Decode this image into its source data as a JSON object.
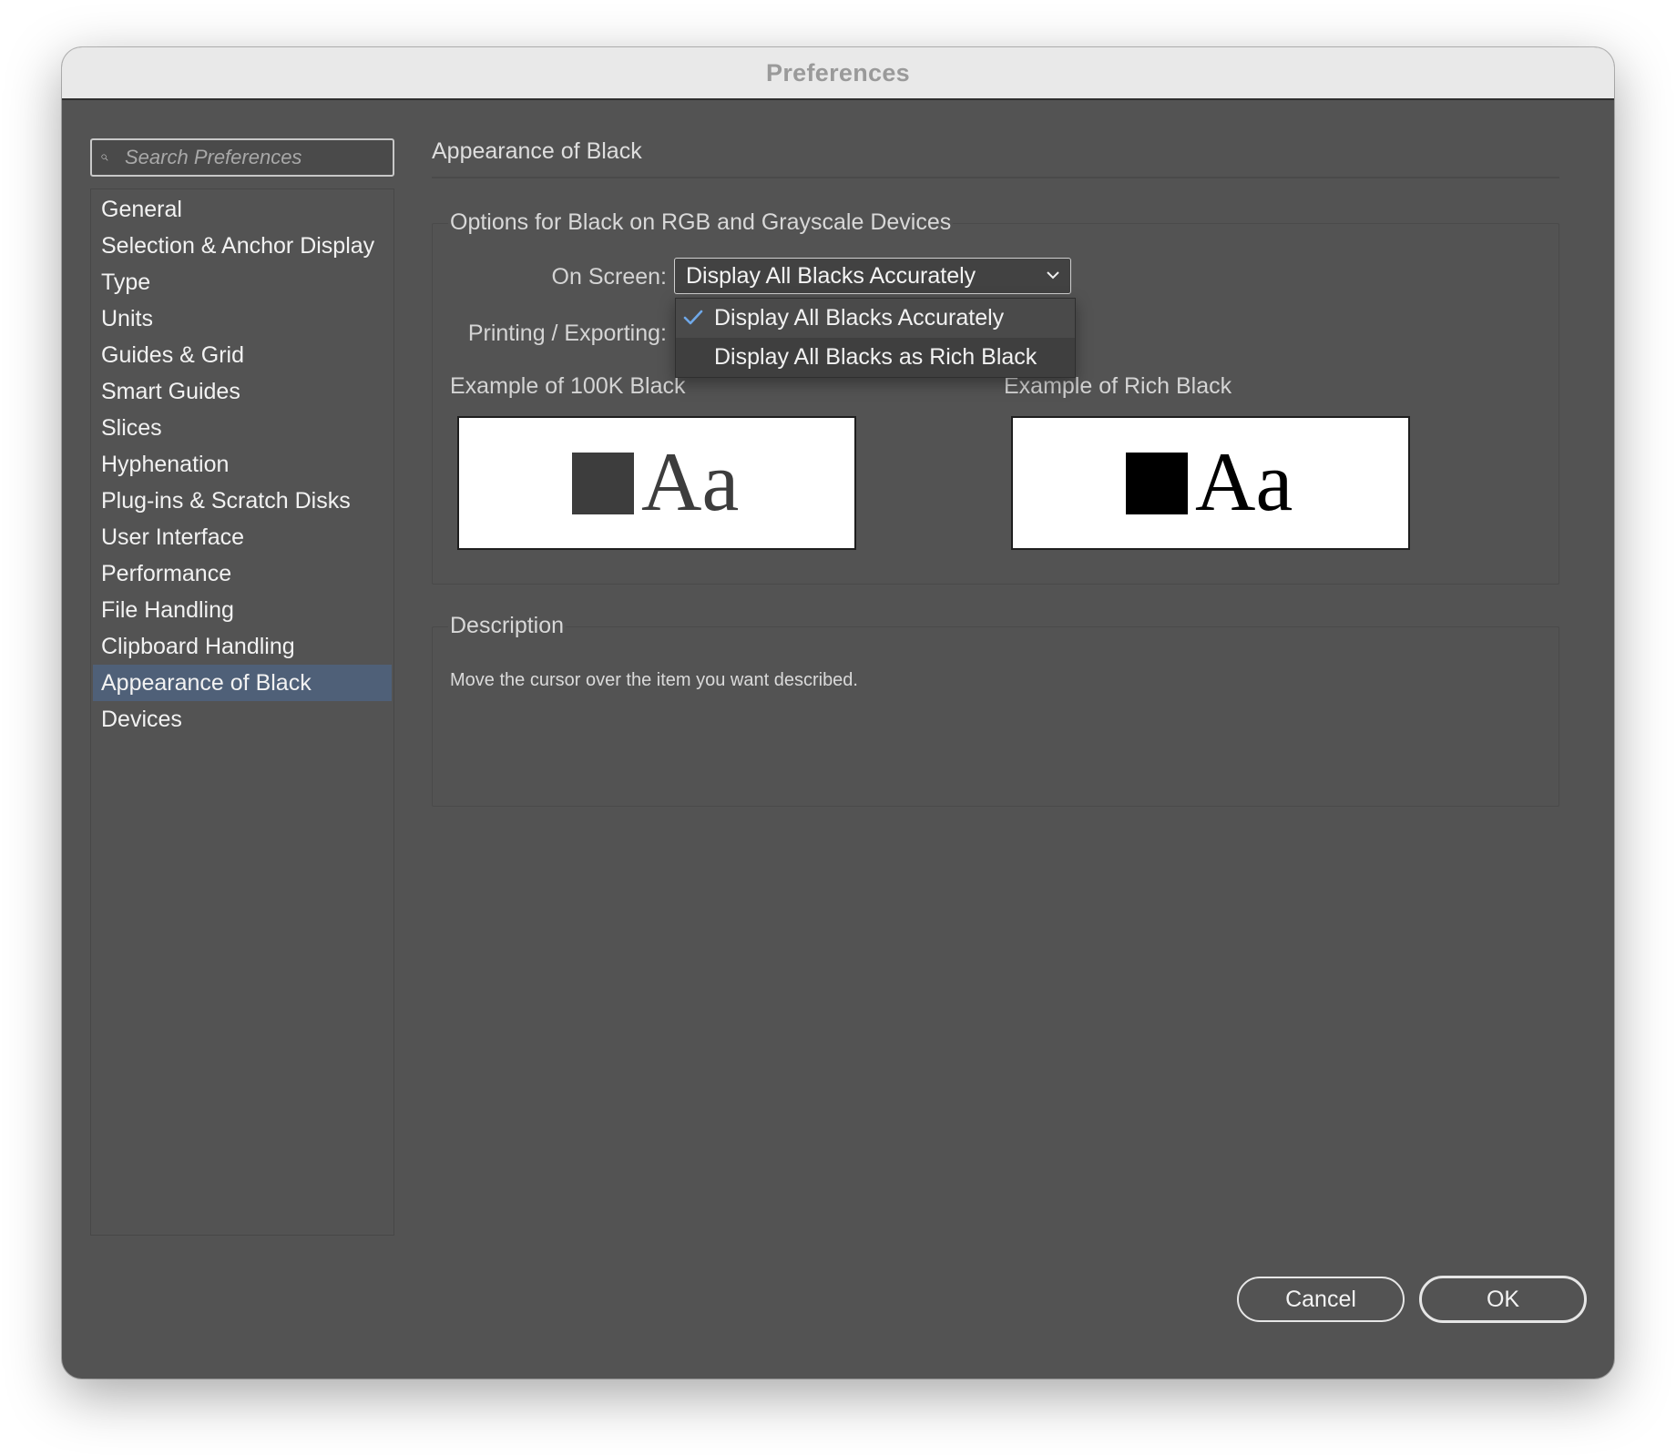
{
  "window": {
    "title": "Preferences"
  },
  "search": {
    "placeholder": "Search Preferences"
  },
  "sidebar": {
    "items": [
      {
        "label": "General"
      },
      {
        "label": "Selection & Anchor Display"
      },
      {
        "label": "Type"
      },
      {
        "label": "Units"
      },
      {
        "label": "Guides & Grid"
      },
      {
        "label": "Smart Guides"
      },
      {
        "label": "Slices"
      },
      {
        "label": "Hyphenation"
      },
      {
        "label": "Plug-ins & Scratch Disks"
      },
      {
        "label": "User Interface"
      },
      {
        "label": "Performance"
      },
      {
        "label": "File Handling"
      },
      {
        "label": "Clipboard Handling"
      },
      {
        "label": "Appearance of Black"
      },
      {
        "label": "Devices"
      }
    ],
    "selected": "Appearance of Black"
  },
  "main": {
    "title": "Appearance of Black",
    "options_group": {
      "label": "Options for Black on RGB and Grayscale Devices",
      "on_screen_label": "On Screen:",
      "on_screen_value": "Display All Blacks Accurately",
      "printing_label": "Printing / Exporting:",
      "dropdown_options": [
        {
          "label": "Display All Blacks Accurately",
          "checked": true
        },
        {
          "label": "Display All Blacks as Rich Black",
          "checked": false
        }
      ],
      "example_100k_label": "Example of 100K Black",
      "example_rich_label": "Example of Rich Black",
      "sample_text": "Aa",
      "colors": {
        "k100": "#3d3d3d",
        "rich": "#000000"
      }
    },
    "description": {
      "label": "Description",
      "text": "Move the cursor over the item you want described."
    }
  },
  "buttons": {
    "cancel": "Cancel",
    "ok": "OK"
  }
}
